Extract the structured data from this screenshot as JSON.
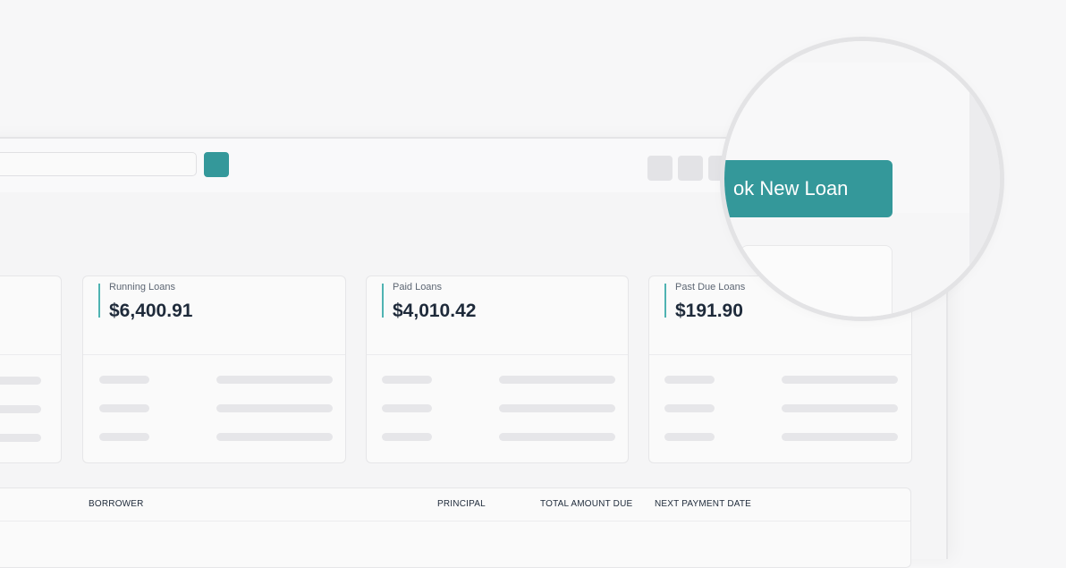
{
  "header": {
    "search_placeholder": "",
    "primary_action_label": "Book New Loan",
    "primary_action_visible_text": "ok New Loan"
  },
  "stats": [
    {
      "label": "Running Loans",
      "value": "$6,400.91"
    },
    {
      "label": "Paid Loans",
      "value": "$4,010.42"
    },
    {
      "label": "Past Due Loans",
      "value": "$191.90"
    }
  ],
  "table": {
    "columns": [
      "BORROWER",
      "PRINCIPAL",
      "TOTAL AMOUNT DUE",
      "NEXT PAYMENT DATE"
    ]
  },
  "colors": {
    "accent": "#34989a",
    "card_accent_bar": "#4fb3b2"
  }
}
